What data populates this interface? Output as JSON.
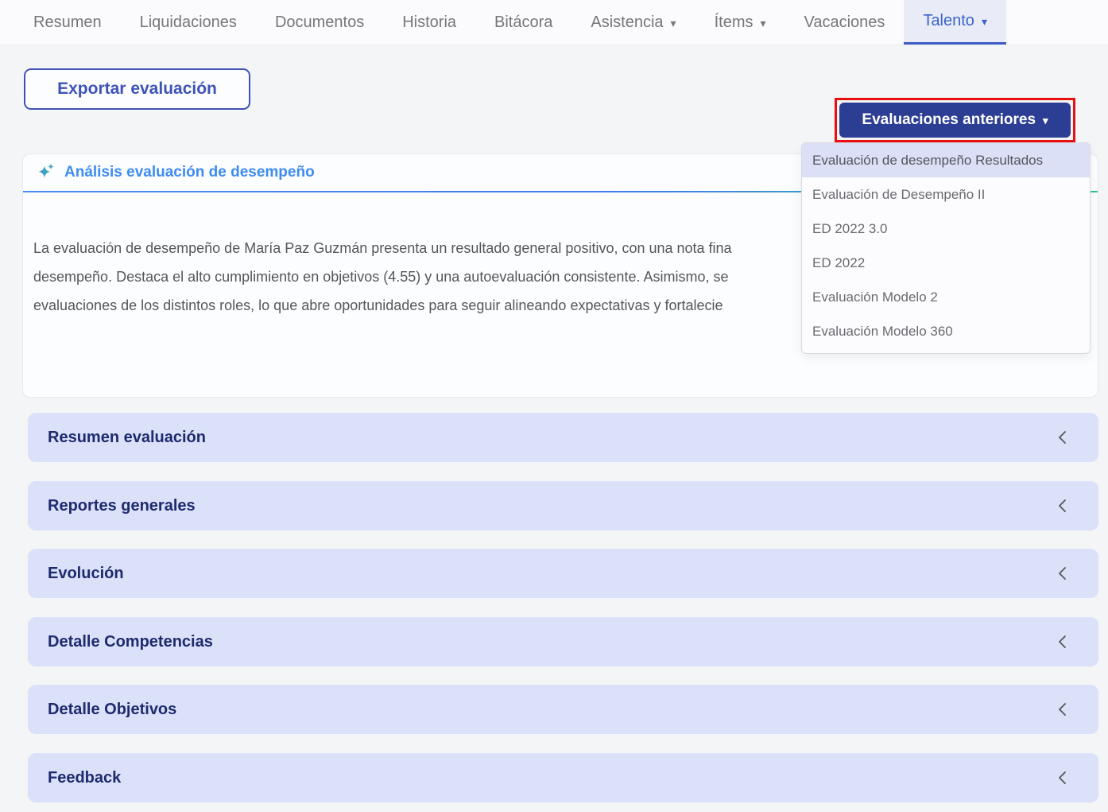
{
  "nav": {
    "tabs": [
      {
        "label": "Resumen",
        "caret": false,
        "active": false
      },
      {
        "label": "Liquidaciones",
        "caret": false,
        "active": false
      },
      {
        "label": "Documentos",
        "caret": false,
        "active": false
      },
      {
        "label": "Historia",
        "caret": false,
        "active": false
      },
      {
        "label": "Bitácora",
        "caret": false,
        "active": false
      },
      {
        "label": "Asistencia",
        "caret": true,
        "active": false
      },
      {
        "label": "Ítems",
        "caret": true,
        "active": false
      },
      {
        "label": "Vacaciones",
        "caret": false,
        "active": false
      },
      {
        "label": "Talento",
        "caret": true,
        "active": true
      }
    ]
  },
  "toolbar": {
    "export_label": "Exportar evaluación",
    "previous_evaluations_label": "Evaluaciones anteriores"
  },
  "icons": {
    "chevron_down": "▾",
    "sparkle": "sparkle-gradient-star"
  },
  "dropdown": {
    "selected": "Evaluación de desempeño Resultados",
    "items": [
      {
        "label": "Evaluación de desempeño Resultados",
        "selected": true
      },
      {
        "label": "Evaluación de Desempeño II",
        "selected": false
      },
      {
        "label": "ED 2022 3.0",
        "selected": false
      },
      {
        "label": "ED 2022",
        "selected": false
      },
      {
        "label": "Evaluación Modelo 2",
        "selected": false
      },
      {
        "label": "Evaluación Modelo 360",
        "selected": false
      }
    ]
  },
  "analysis_card": {
    "title": "Análisis evaluación de desempeño",
    "lines": [
      "La evaluación de desempeño de María Paz Guzmán presenta un resultado general positivo, con una nota fina",
      "desempeño. Destaca el alto cumplimiento en objetivos (4.55) y una autoevaluación consistente. Asimismo, se",
      "evaluaciones de los distintos roles, lo que abre oportunidades para seguir alineando expectativas y fortalecie"
    ]
  },
  "sections": [
    {
      "label": "Resumen evaluación"
    },
    {
      "label": "Reportes generales"
    },
    {
      "label": "Evolución"
    },
    {
      "label": "Detalle Competencias"
    },
    {
      "label": "Detalle Objetivos"
    },
    {
      "label": "Feedback"
    }
  ],
  "colors": {
    "page_bg": "#f4f5f7",
    "nav_text": "#76767b",
    "active_tab_blue": "#3c63cb",
    "active_tab_underline": "#3b5bc4",
    "export_button_blue": "#3e53b8",
    "primary_button_bg": "#2c3e94",
    "annotation_red": "#e8100e",
    "selected_item_bg": "#dbe0f7",
    "card_title_blue": "#3d8bf3",
    "gradient_start": "#4b8df6",
    "gradient_end": "#2fc48f",
    "body_text": "#55565b",
    "accordion_bg": "#dbe1f8",
    "accordion_text": "#1e2a6e"
  }
}
